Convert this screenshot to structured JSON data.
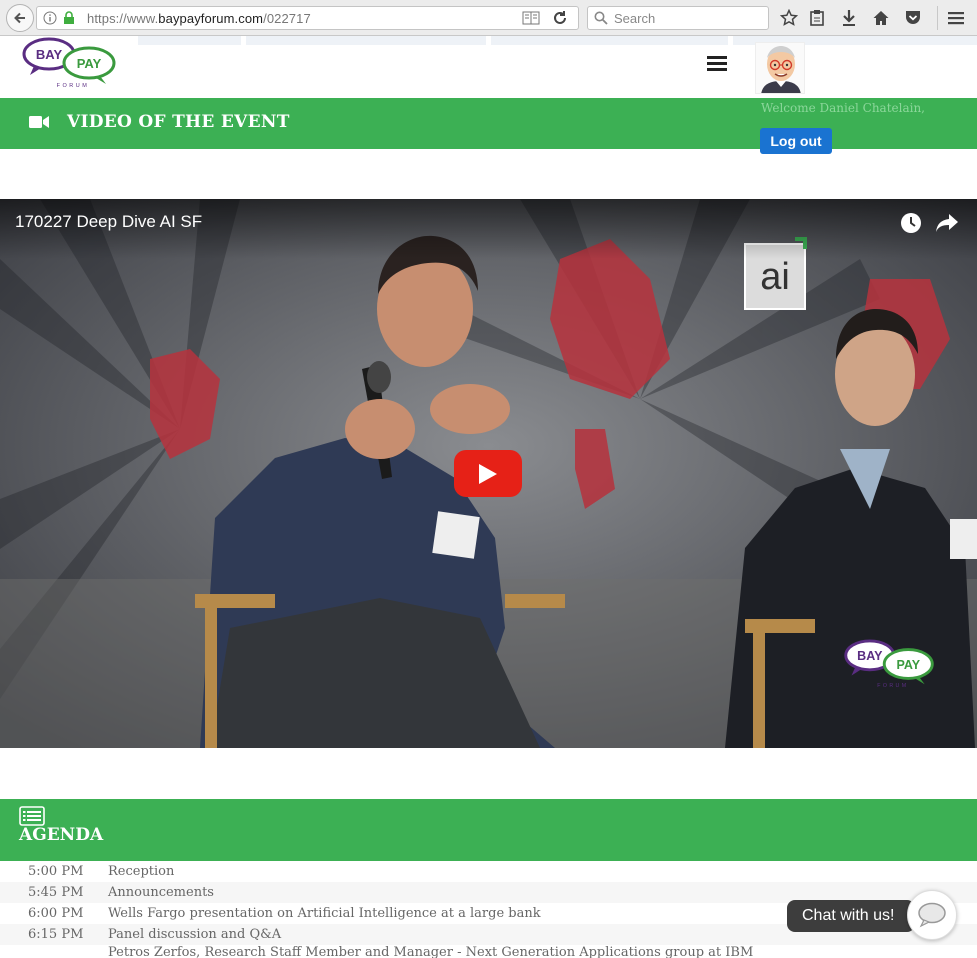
{
  "browser": {
    "url_prefix": "https://www.",
    "url_domain": "baypayforum.com",
    "url_path": "/022717",
    "search_placeholder": "Search"
  },
  "site": {
    "logo_word1": "BAY",
    "logo_word2": "PAY",
    "logo_sub": "FORUM",
    "welcome": "Welcome Daniel Chatelain,",
    "logout_label": "Log out"
  },
  "video_section": {
    "title": "VIDEO OF THE EVENT",
    "video_title": "170227 Deep Dive AI SF"
  },
  "agenda": {
    "title": "AGENDA",
    "items": [
      {
        "time": "5:00 PM",
        "desc": "Reception"
      },
      {
        "time": "5:45 PM",
        "desc": "Announcements"
      },
      {
        "time": "6:00 PM",
        "desc": "Wells Fargo presentation on Artificial Intelligence at a large bank"
      },
      {
        "time": "6:15 PM",
        "desc": "Panel discussion and Q&A"
      },
      {
        "time": "",
        "desc": "Petros Zerfos, Research Staff Member and Manager - Next Generation Applications group at IBM"
      }
    ]
  },
  "chat": {
    "label": "Chat with us!"
  },
  "colors": {
    "green": "#3cb054",
    "blue": "#1a73d1",
    "youtube_red": "#e62117",
    "logo_purple": "#5a2d82",
    "logo_green": "#3a9a3e"
  }
}
